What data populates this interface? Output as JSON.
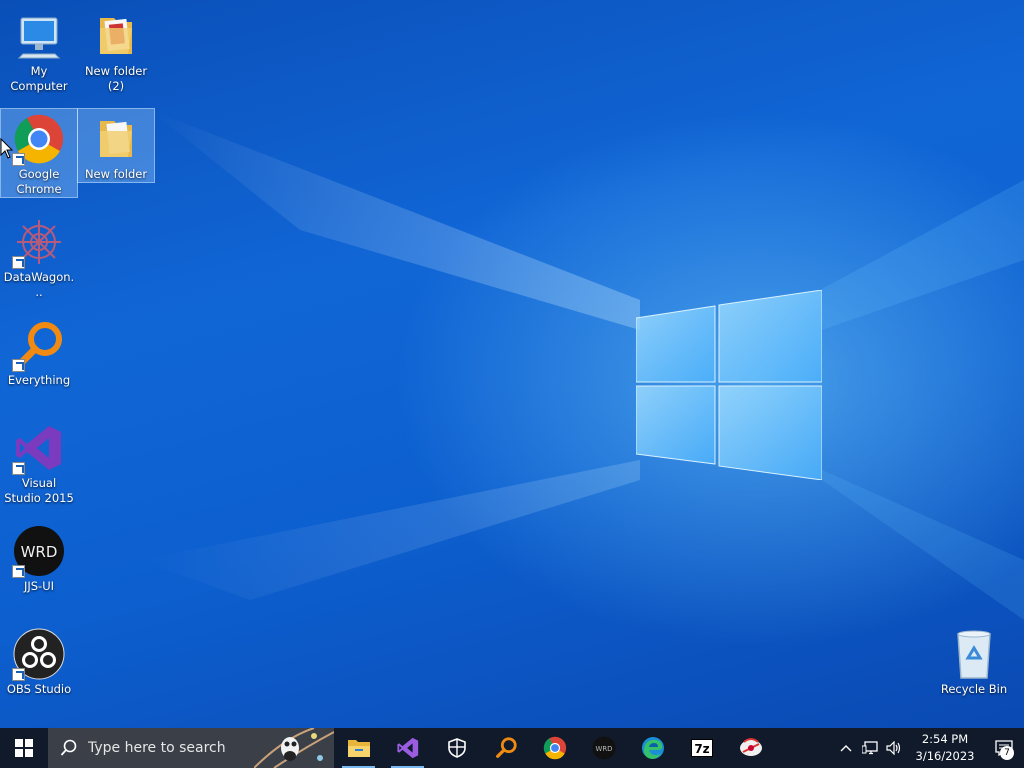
{
  "desktop": {
    "icons": [
      {
        "label": "My Computer",
        "icon": "computer-icon"
      },
      {
        "label": "New folder (2)",
        "icon": "folder-icon"
      },
      {
        "label": "Google Chrome",
        "icon": "chrome-icon"
      },
      {
        "label": "New folder",
        "icon": "folder-icon"
      },
      {
        "label": "DataWagon...",
        "icon": "datawagon-icon"
      },
      {
        "label": "Everything",
        "icon": "everything-icon"
      },
      {
        "label": "Visual Studio 2015",
        "icon": "visual-studio-icon"
      },
      {
        "label": "JJS-UI",
        "icon": "wrd-icon"
      },
      {
        "label": "OBS Studio",
        "icon": "obs-icon"
      },
      {
        "label": "Recycle Bin",
        "icon": "recycle-bin-icon"
      }
    ],
    "wrd_text": "WRD"
  },
  "taskbar": {
    "search_placeholder": "Type here to search",
    "apps": [
      {
        "name": "File Explorer",
        "icon": "file-explorer-icon"
      },
      {
        "name": "Visual Studio",
        "icon": "visual-studio-icon"
      },
      {
        "name": "Windows Security",
        "icon": "shield-icon"
      },
      {
        "name": "Everything",
        "icon": "everything-icon"
      },
      {
        "name": "Google Chrome",
        "icon": "chrome-icon"
      },
      {
        "name": "WRD",
        "icon": "wrd-icon"
      },
      {
        "name": "Microsoft Edge",
        "icon": "edge-icon"
      },
      {
        "name": "7-Zip",
        "icon": "7zip-icon"
      },
      {
        "name": "App",
        "icon": "app-icon"
      }
    ],
    "sevenzip_text": "7z",
    "clock": {
      "time": "2:54 PM",
      "date": "3/16/2023"
    },
    "notification_count": "7"
  },
  "colors": {
    "desktop_blue": "#0d5fcf",
    "taskbar": "#101a2b",
    "search_box": "#3a3f48"
  }
}
